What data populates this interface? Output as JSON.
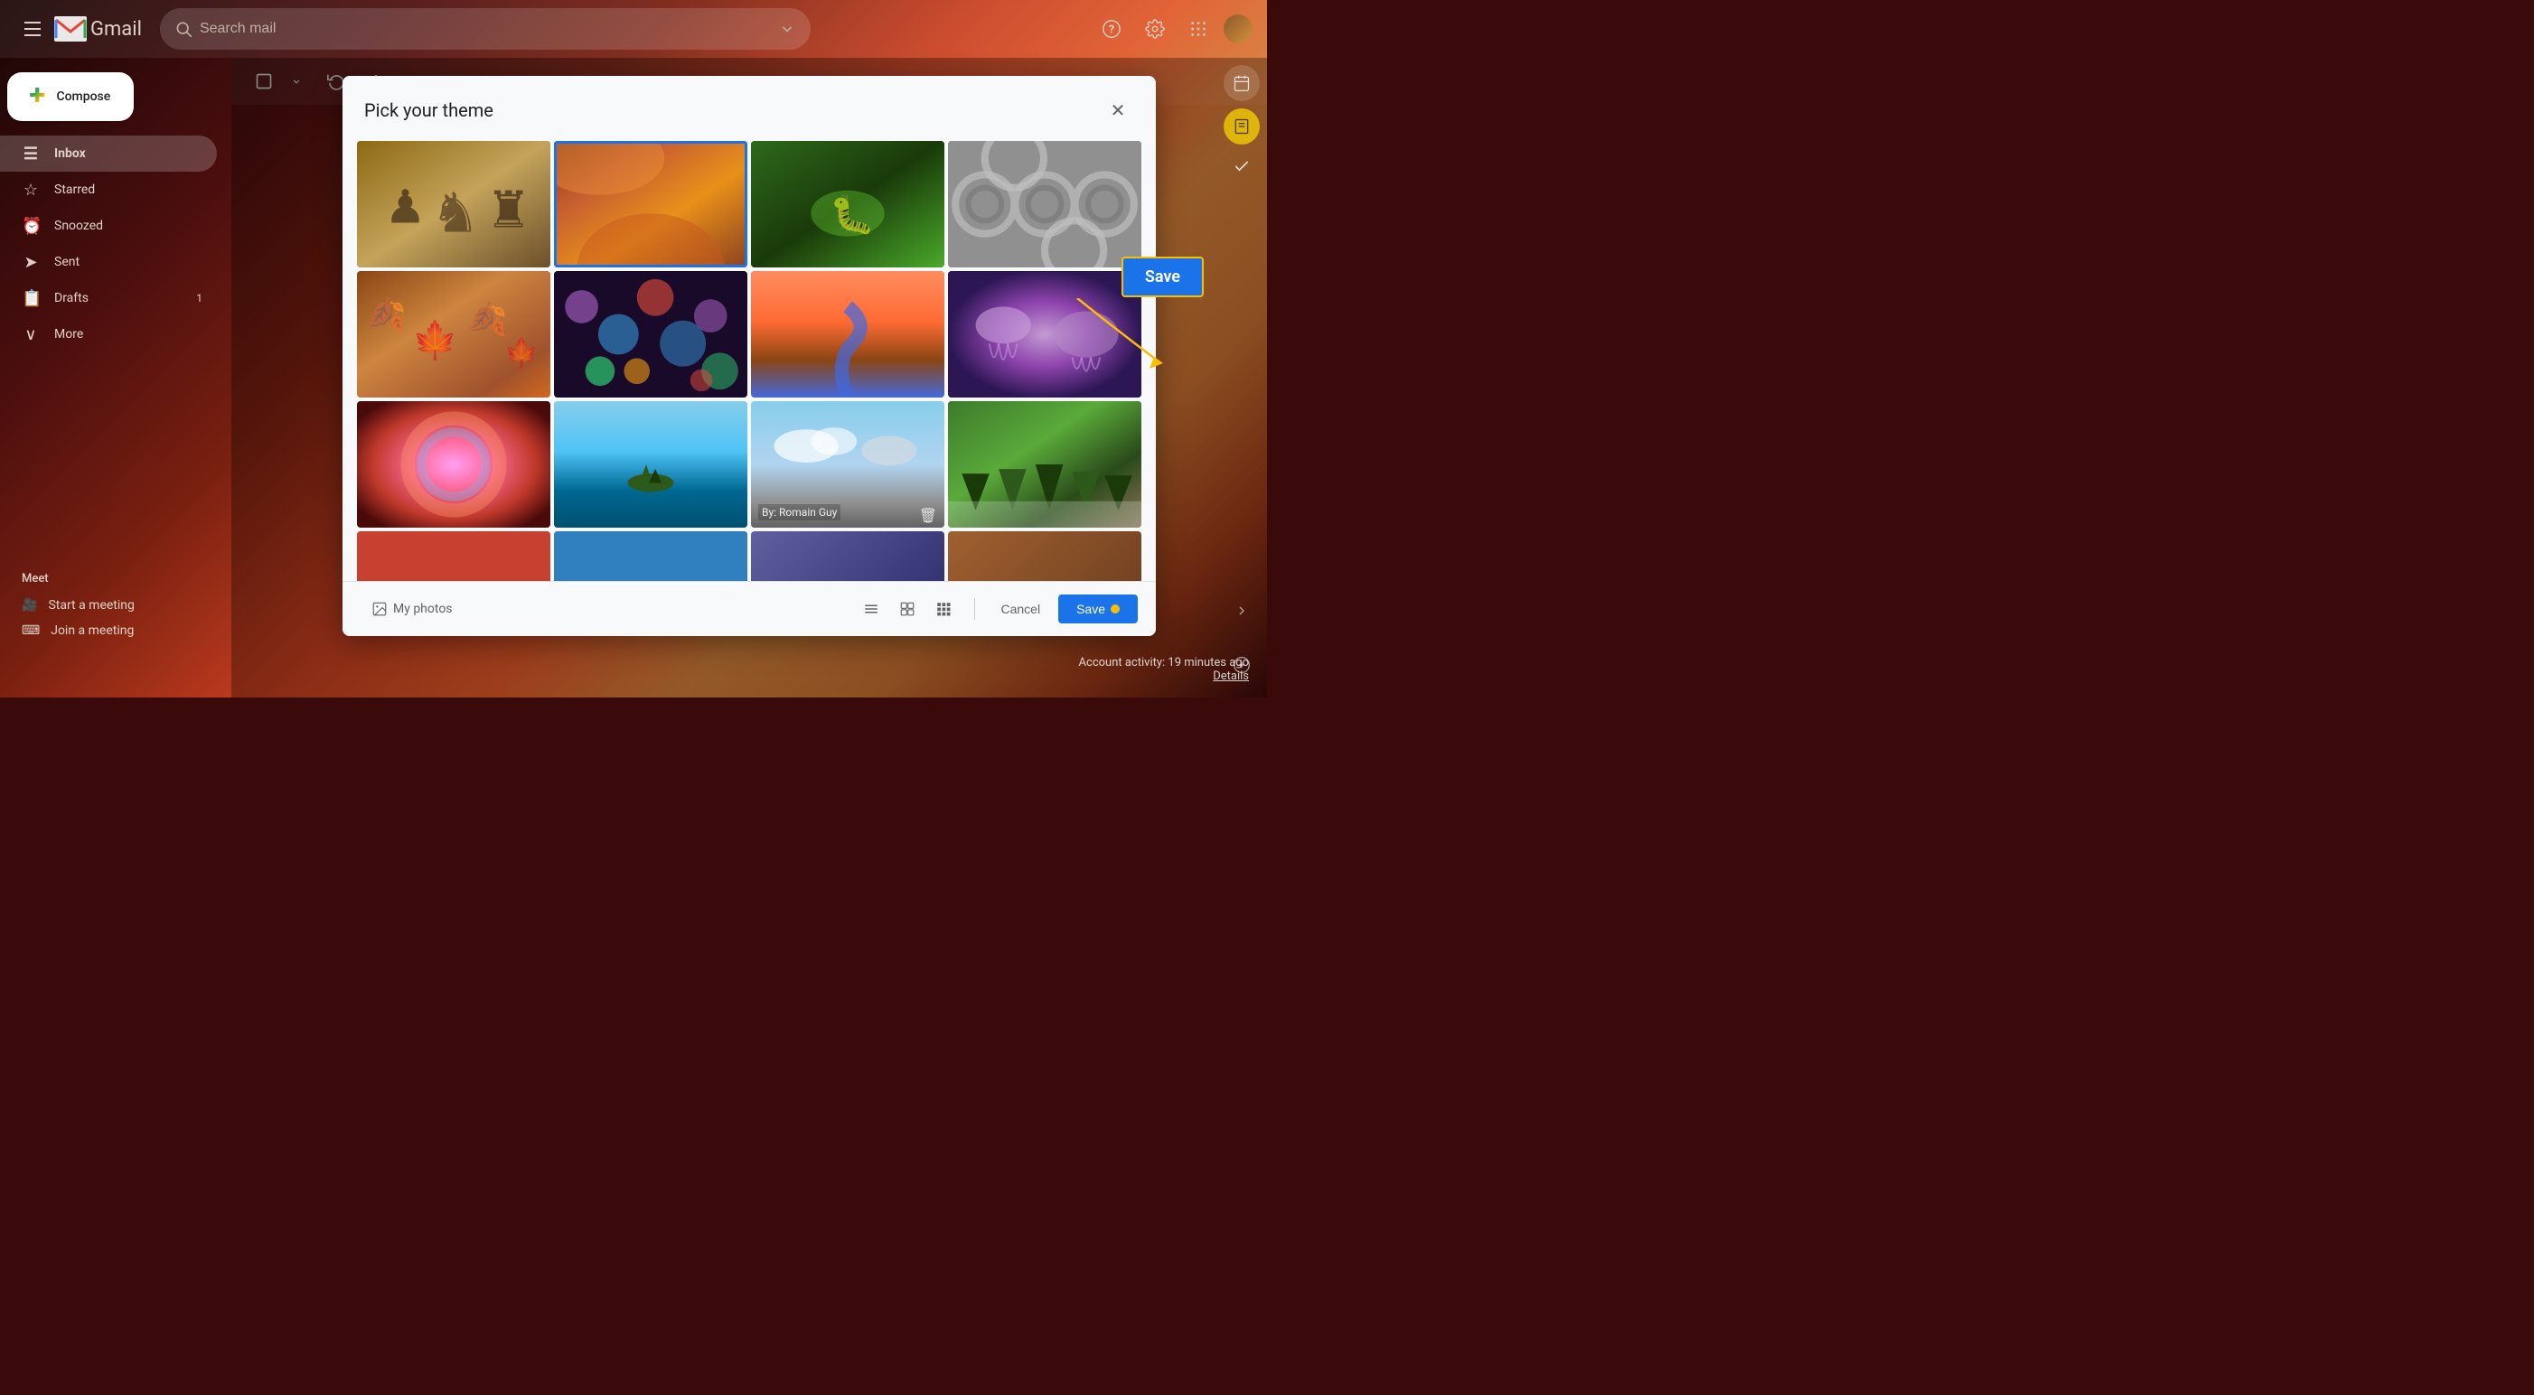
{
  "app": {
    "title": "Gmail"
  },
  "header": {
    "menu_label": "Menu",
    "logo_alt": "Gmail",
    "search_placeholder": "Search mail",
    "help_icon": "help-icon",
    "settings_icon": "settings-icon",
    "apps_icon": "apps-icon"
  },
  "sidebar": {
    "compose_label": "Compose",
    "nav_items": [
      {
        "id": "inbox",
        "label": "Inbox",
        "icon": "☰",
        "active": true
      },
      {
        "id": "starred",
        "label": "Starred",
        "icon": "★",
        "active": false
      },
      {
        "id": "snoozed",
        "label": "Snoozed",
        "icon": "🕐",
        "active": false
      },
      {
        "id": "sent",
        "label": "Sent",
        "icon": "➤",
        "active": false
      },
      {
        "id": "drafts",
        "label": "Drafts",
        "icon": "📄",
        "badge": "1",
        "active": false
      },
      {
        "id": "more",
        "label": "More",
        "icon": "∨",
        "active": false
      }
    ],
    "meet": {
      "title": "Meet",
      "items": [
        {
          "id": "start-meeting",
          "label": "Start a meeting",
          "icon": "🎥"
        },
        {
          "id": "join-meeting",
          "label": "Join a meeting",
          "icon": "⌨"
        }
      ]
    }
  },
  "dialog": {
    "title": "Pick your theme",
    "close_label": "×",
    "themes": [
      {
        "id": "chess",
        "label": "Chess pieces",
        "css_class": "theme-chess",
        "selected": false,
        "credit": ""
      },
      {
        "id": "canyon",
        "label": "Canyon",
        "css_class": "theme-canyon",
        "selected": true,
        "credit": ""
      },
      {
        "id": "caterpillar",
        "label": "Caterpillar",
        "css_class": "theme-caterpillar",
        "selected": false,
        "credit": ""
      },
      {
        "id": "tubes",
        "label": "Tubes",
        "css_class": "theme-tubes",
        "selected": false,
        "credit": ""
      },
      {
        "id": "leaves",
        "label": "Autumn leaves",
        "css_class": "theme-leaves",
        "selected": false,
        "credit": ""
      },
      {
        "id": "bokeh",
        "label": "Bokeh",
        "css_class": "theme-bokeh",
        "selected": false,
        "credit": ""
      },
      {
        "id": "river",
        "label": "River canyon",
        "css_class": "theme-river",
        "selected": false,
        "credit": ""
      },
      {
        "id": "jellyfish",
        "label": "Jellyfish",
        "css_class": "theme-jellyfish",
        "selected": false,
        "credit": ""
      },
      {
        "id": "bubble",
        "label": "Bubble",
        "css_class": "theme-bubble",
        "selected": false,
        "credit": ""
      },
      {
        "id": "lake",
        "label": "Lake island",
        "css_class": "theme-lake",
        "selected": false,
        "credit": ""
      },
      {
        "id": "sky",
        "label": "Cloudy sky",
        "css_class": "theme-sky",
        "selected": false,
        "credit": "By: Romain Guy"
      },
      {
        "id": "forest",
        "label": "Forest",
        "css_class": "theme-forest",
        "selected": false,
        "credit": ""
      }
    ],
    "footer": {
      "my_photos_label": "My photos",
      "cancel_label": "Cancel",
      "save_label": "Save"
    }
  },
  "save_callout": {
    "label": "Save"
  },
  "account_status": {
    "line1": "Account activity: 19 minutes ago",
    "line2": "Details"
  }
}
